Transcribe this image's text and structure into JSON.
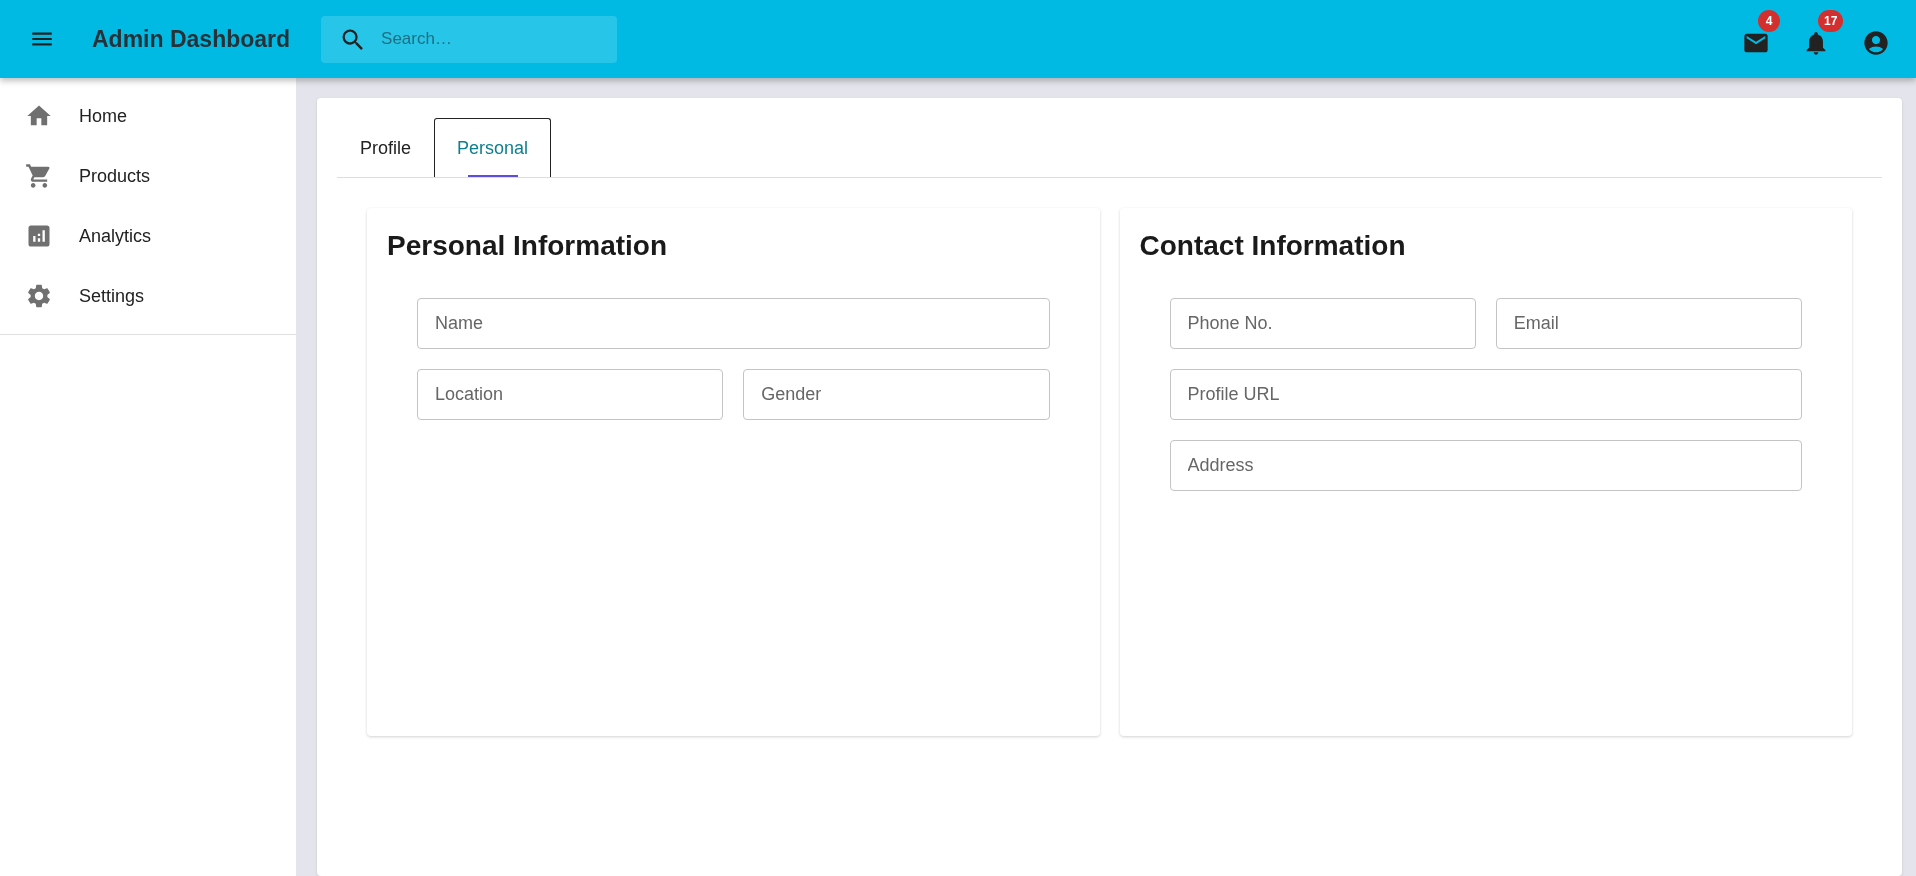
{
  "app_bar": {
    "title": "Admin Dashboard",
    "search": {
      "placeholder": "Search…"
    },
    "actions": [
      {
        "kind": "mail",
        "badge": "4"
      },
      {
        "kind": "bell",
        "badge": "17"
      },
      {
        "kind": "account"
      }
    ]
  },
  "sidebar": {
    "items": [
      {
        "label": "Home"
      },
      {
        "label": "Products"
      },
      {
        "label": "Analytics"
      },
      {
        "label": "Settings"
      }
    ]
  },
  "tabs": [
    {
      "label": "Profile",
      "selected": false
    },
    {
      "label": "Personal",
      "selected": true
    }
  ],
  "sections": [
    {
      "title": "Personal Information",
      "rows": [
        [
          {
            "placeholder": "Name"
          }
        ],
        [
          {
            "placeholder": "Location"
          },
          {
            "placeholder": "Gender"
          }
        ]
      ]
    },
    {
      "title": "Contact Information",
      "rows": [
        [
          {
            "placeholder": "Phone No."
          },
          {
            "placeholder": "Email"
          }
        ],
        [
          {
            "placeholder": "Profile URL"
          }
        ],
        [
          {
            "placeholder": "Address"
          }
        ]
      ]
    }
  ]
}
